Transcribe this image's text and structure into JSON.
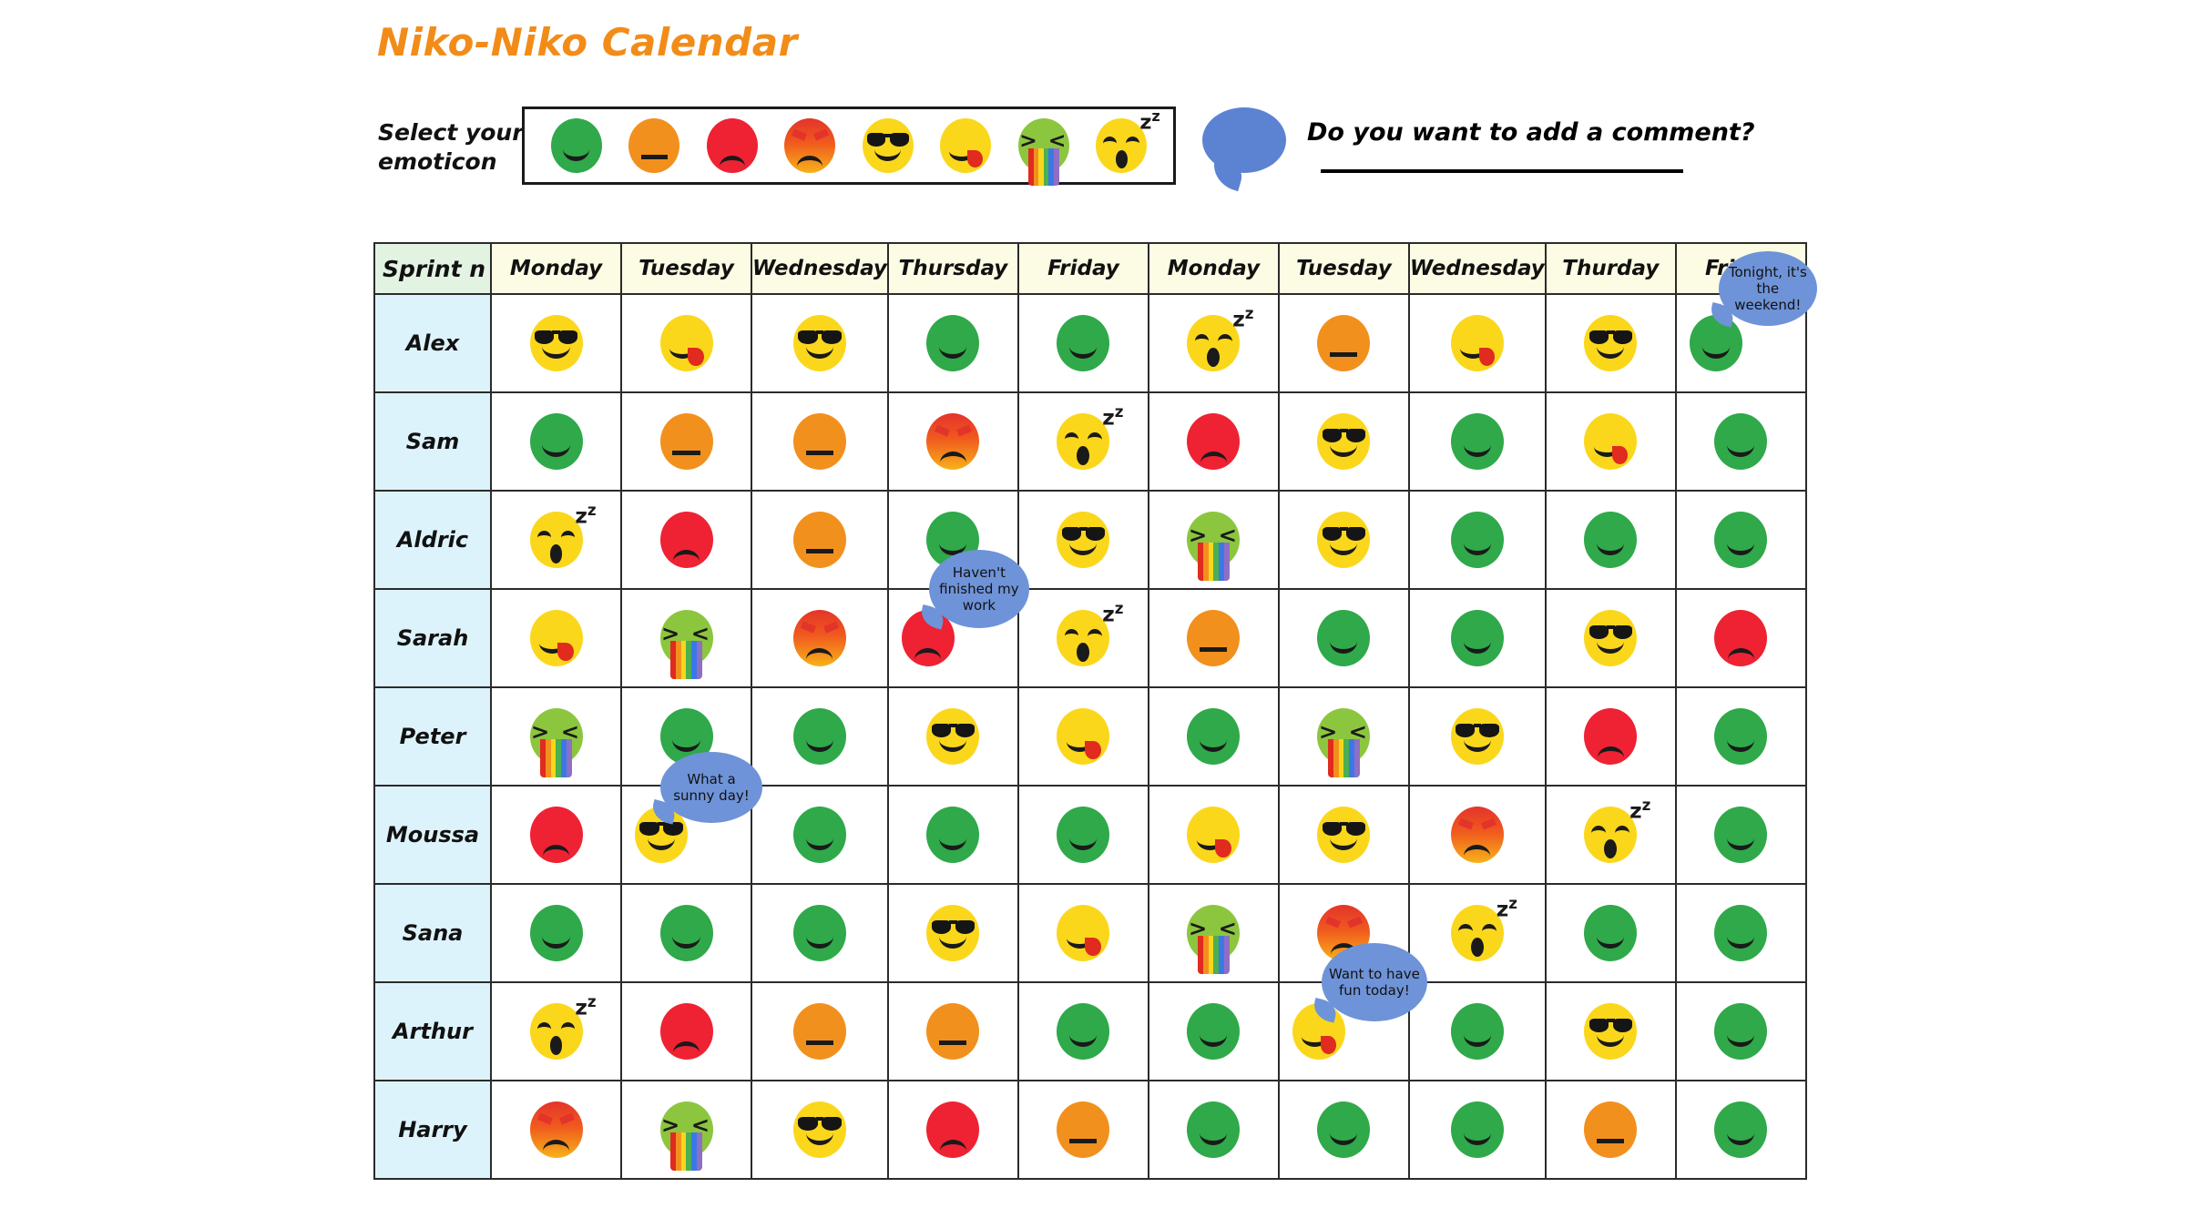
{
  "title": "Niko-Niko Calendar",
  "selector": {
    "label_line1": "Select your",
    "label_line2": "emoticon",
    "emoticons": [
      {
        "key": "happy",
        "name": "green-happy-face",
        "alt": "Green happy face"
      },
      {
        "key": "neutral",
        "name": "orange-neutral-face",
        "alt": "Orange neutral face"
      },
      {
        "key": "sad",
        "name": "red-sad-face",
        "alt": "Red sad crying face"
      },
      {
        "key": "angry",
        "name": "red-angry-face",
        "alt": "Red angry face"
      },
      {
        "key": "cool",
        "name": "yellow-sunglasses-face",
        "alt": "Yellow face with sunglasses"
      },
      {
        "key": "tongue",
        "name": "yellow-tongue-face",
        "alt": "Yellow face sticking tongue out"
      },
      {
        "key": "rainbow",
        "name": "green-rainbow-vomit-face",
        "alt": "Green face vomiting rainbow"
      },
      {
        "key": "sleep",
        "name": "yellow-sleeping-face",
        "alt": "Yellow sleeping face with Zz"
      }
    ]
  },
  "comment_prompt": {
    "text": "Do you want to add a comment?",
    "bubble_icon": "speech-bubble-icon"
  },
  "table": {
    "corner_label": "Sprint n",
    "columns": [
      "Monday",
      "Tuesday",
      "Wednesday",
      "Thursday",
      "Friday",
      "Monday",
      "Tuesday",
      "Wednesday",
      "Thurday",
      "Friday"
    ],
    "rows": [
      {
        "name": "Alex",
        "cells": [
          {
            "emoticon": "cool"
          },
          {
            "emoticon": "tongue"
          },
          {
            "emoticon": "cool"
          },
          {
            "emoticon": "happy"
          },
          {
            "emoticon": "happy"
          },
          {
            "emoticon": "sleep"
          },
          {
            "emoticon": "neutral"
          },
          {
            "emoticon": "tongue"
          },
          {
            "emoticon": "cool"
          },
          {
            "emoticon": "happy",
            "comment": "Tonight, it's the weekend!",
            "bubble_class": "b-alex"
          }
        ]
      },
      {
        "name": "Sam",
        "cells": [
          {
            "emoticon": "happy"
          },
          {
            "emoticon": "neutral"
          },
          {
            "emoticon": "neutral"
          },
          {
            "emoticon": "angry"
          },
          {
            "emoticon": "sleep"
          },
          {
            "emoticon": "sad"
          },
          {
            "emoticon": "cool"
          },
          {
            "emoticon": "happy"
          },
          {
            "emoticon": "tongue"
          },
          {
            "emoticon": "happy"
          }
        ]
      },
      {
        "name": "Aldric",
        "cells": [
          {
            "emoticon": "sleep"
          },
          {
            "emoticon": "sad"
          },
          {
            "emoticon": "neutral"
          },
          {
            "emoticon": "happy"
          },
          {
            "emoticon": "cool"
          },
          {
            "emoticon": "rainbow"
          },
          {
            "emoticon": "cool"
          },
          {
            "emoticon": "happy"
          },
          {
            "emoticon": "happy"
          },
          {
            "emoticon": "happy"
          }
        ]
      },
      {
        "name": "Sarah",
        "cells": [
          {
            "emoticon": "tongue"
          },
          {
            "emoticon": "rainbow"
          },
          {
            "emoticon": "angry"
          },
          {
            "emoticon": "sad",
            "comment": "Haven't finished my work",
            "bubble_class": "b-sarah"
          },
          {
            "emoticon": "sleep"
          },
          {
            "emoticon": "neutral"
          },
          {
            "emoticon": "happy"
          },
          {
            "emoticon": "happy"
          },
          {
            "emoticon": "cool"
          },
          {
            "emoticon": "sad"
          }
        ]
      },
      {
        "name": "Peter",
        "cells": [
          {
            "emoticon": "rainbow"
          },
          {
            "emoticon": "happy"
          },
          {
            "emoticon": "happy"
          },
          {
            "emoticon": "cool"
          },
          {
            "emoticon": "tongue"
          },
          {
            "emoticon": "happy"
          },
          {
            "emoticon": "rainbow"
          },
          {
            "emoticon": "cool"
          },
          {
            "emoticon": "sad"
          },
          {
            "emoticon": "happy"
          }
        ]
      },
      {
        "name": "Moussa",
        "cells": [
          {
            "emoticon": "sad"
          },
          {
            "emoticon": "cool",
            "comment": "What a sunny day!",
            "bubble_class": "b-moussa"
          },
          {
            "emoticon": "happy"
          },
          {
            "emoticon": "happy"
          },
          {
            "emoticon": "happy"
          },
          {
            "emoticon": "tongue"
          },
          {
            "emoticon": "cool"
          },
          {
            "emoticon": "angry"
          },
          {
            "emoticon": "sleep"
          },
          {
            "emoticon": "happy"
          }
        ]
      },
      {
        "name": "Sana",
        "cells": [
          {
            "emoticon": "happy"
          },
          {
            "emoticon": "happy"
          },
          {
            "emoticon": "happy"
          },
          {
            "emoticon": "cool"
          },
          {
            "emoticon": "tongue"
          },
          {
            "emoticon": "rainbow"
          },
          {
            "emoticon": "angry"
          },
          {
            "emoticon": "sleep"
          },
          {
            "emoticon": "happy"
          },
          {
            "emoticon": "happy"
          }
        ]
      },
      {
        "name": "Arthur",
        "cells": [
          {
            "emoticon": "sleep"
          },
          {
            "emoticon": "sad"
          },
          {
            "emoticon": "neutral"
          },
          {
            "emoticon": "neutral"
          },
          {
            "emoticon": "happy"
          },
          {
            "emoticon": "happy"
          },
          {
            "emoticon": "tongue",
            "comment": "Want to have fun today!",
            "bubble_class": "b-arthur"
          },
          {
            "emoticon": "happy"
          },
          {
            "emoticon": "cool"
          },
          {
            "emoticon": "happy"
          }
        ]
      },
      {
        "name": "Harry",
        "cells": [
          {
            "emoticon": "angry"
          },
          {
            "emoticon": "rainbow"
          },
          {
            "emoticon": "cool"
          },
          {
            "emoticon": "sad"
          },
          {
            "emoticon": "neutral"
          },
          {
            "emoticon": "happy"
          },
          {
            "emoticon": "happy"
          },
          {
            "emoticon": "happy"
          },
          {
            "emoticon": "neutral"
          },
          {
            "emoticon": "happy"
          }
        ]
      }
    ]
  },
  "colors": {
    "title": "#F28C18",
    "happy": "#2FA94A",
    "neutral": "#F2901E",
    "sad": "#EE2233",
    "angry": "#E3342B",
    "cool": "#FBD71C",
    "tongue": "#FBD71C",
    "rainbow": "#8CC63F",
    "sleep": "#FBD71C",
    "bubble": "#6E93D8",
    "header_bg": "#FCFBE3",
    "corner_bg": "#E2F3E2",
    "name_bg": "#DDF3FB"
  }
}
